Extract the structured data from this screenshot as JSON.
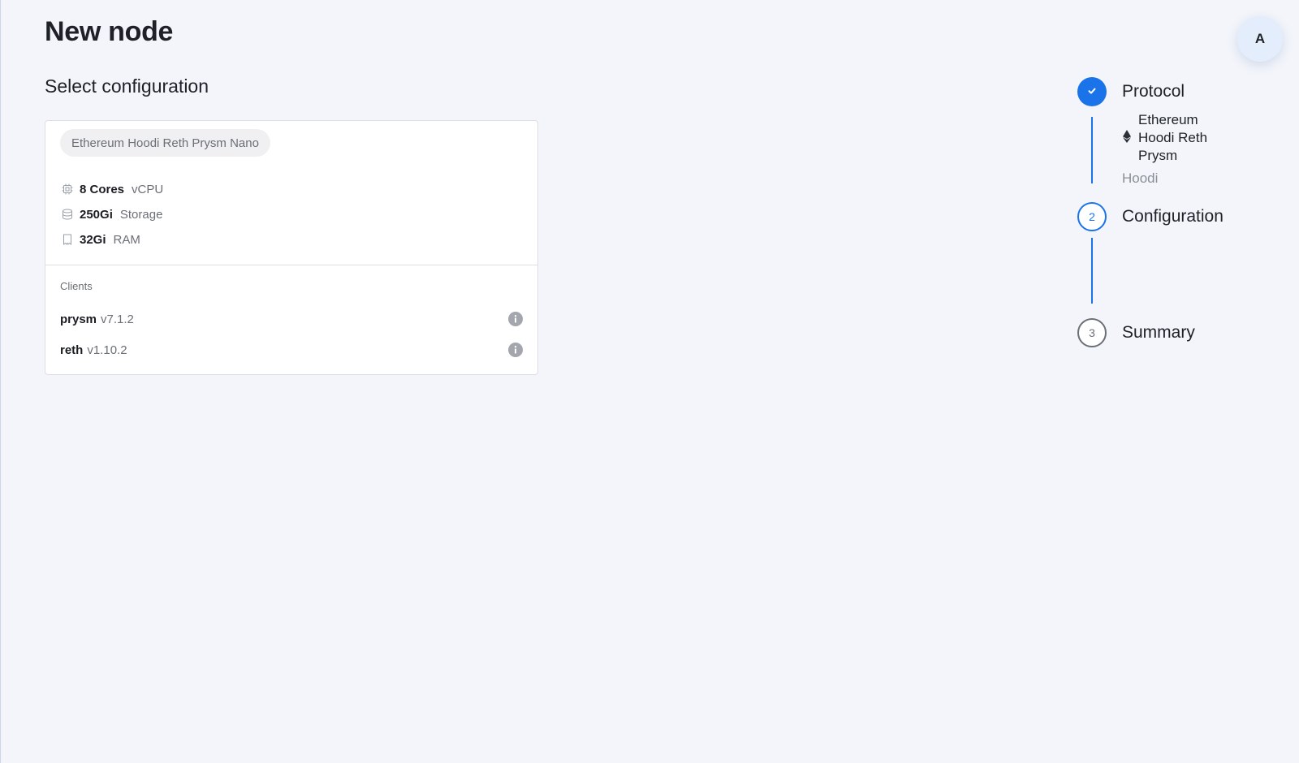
{
  "page": {
    "title": "New node",
    "section_title": "Select configuration"
  },
  "user": {
    "avatar_initial": "A"
  },
  "config_card": {
    "tier_label": "Ethereum Hoodi Reth Prysm Nano",
    "specs": [
      {
        "icon": "cpu-icon",
        "value": "8 Cores",
        "label": "vCPU"
      },
      {
        "icon": "storage-icon",
        "value": "250Gi",
        "label": "Storage"
      },
      {
        "icon": "ram-icon",
        "value": "32Gi",
        "label": "RAM"
      }
    ],
    "clients_label": "Clients",
    "clients": [
      {
        "name": "prysm",
        "version": "v7.1.2",
        "icon": "info-icon"
      },
      {
        "name": "reth",
        "version": "v1.10.2",
        "icon": "info-icon"
      }
    ]
  },
  "stepper": {
    "steps": [
      {
        "index": "1",
        "label": "Protocol",
        "status": "completed",
        "icon": "check-icon"
      },
      {
        "index": "2",
        "label": "Configuration",
        "status": "active"
      },
      {
        "index": "3",
        "label": "Summary",
        "status": "pending"
      }
    ],
    "protocol_selection": {
      "icon": "ethereum-icon",
      "lines": [
        "Ethereum",
        "Hoodi Reth",
        "Prysm"
      ],
      "network": "Hoodi"
    }
  },
  "colors": {
    "accent": "#1a73e8",
    "background": "#f3f5fa",
    "muted_text": "#6b6f76",
    "pending_step": "#6b6f76"
  }
}
